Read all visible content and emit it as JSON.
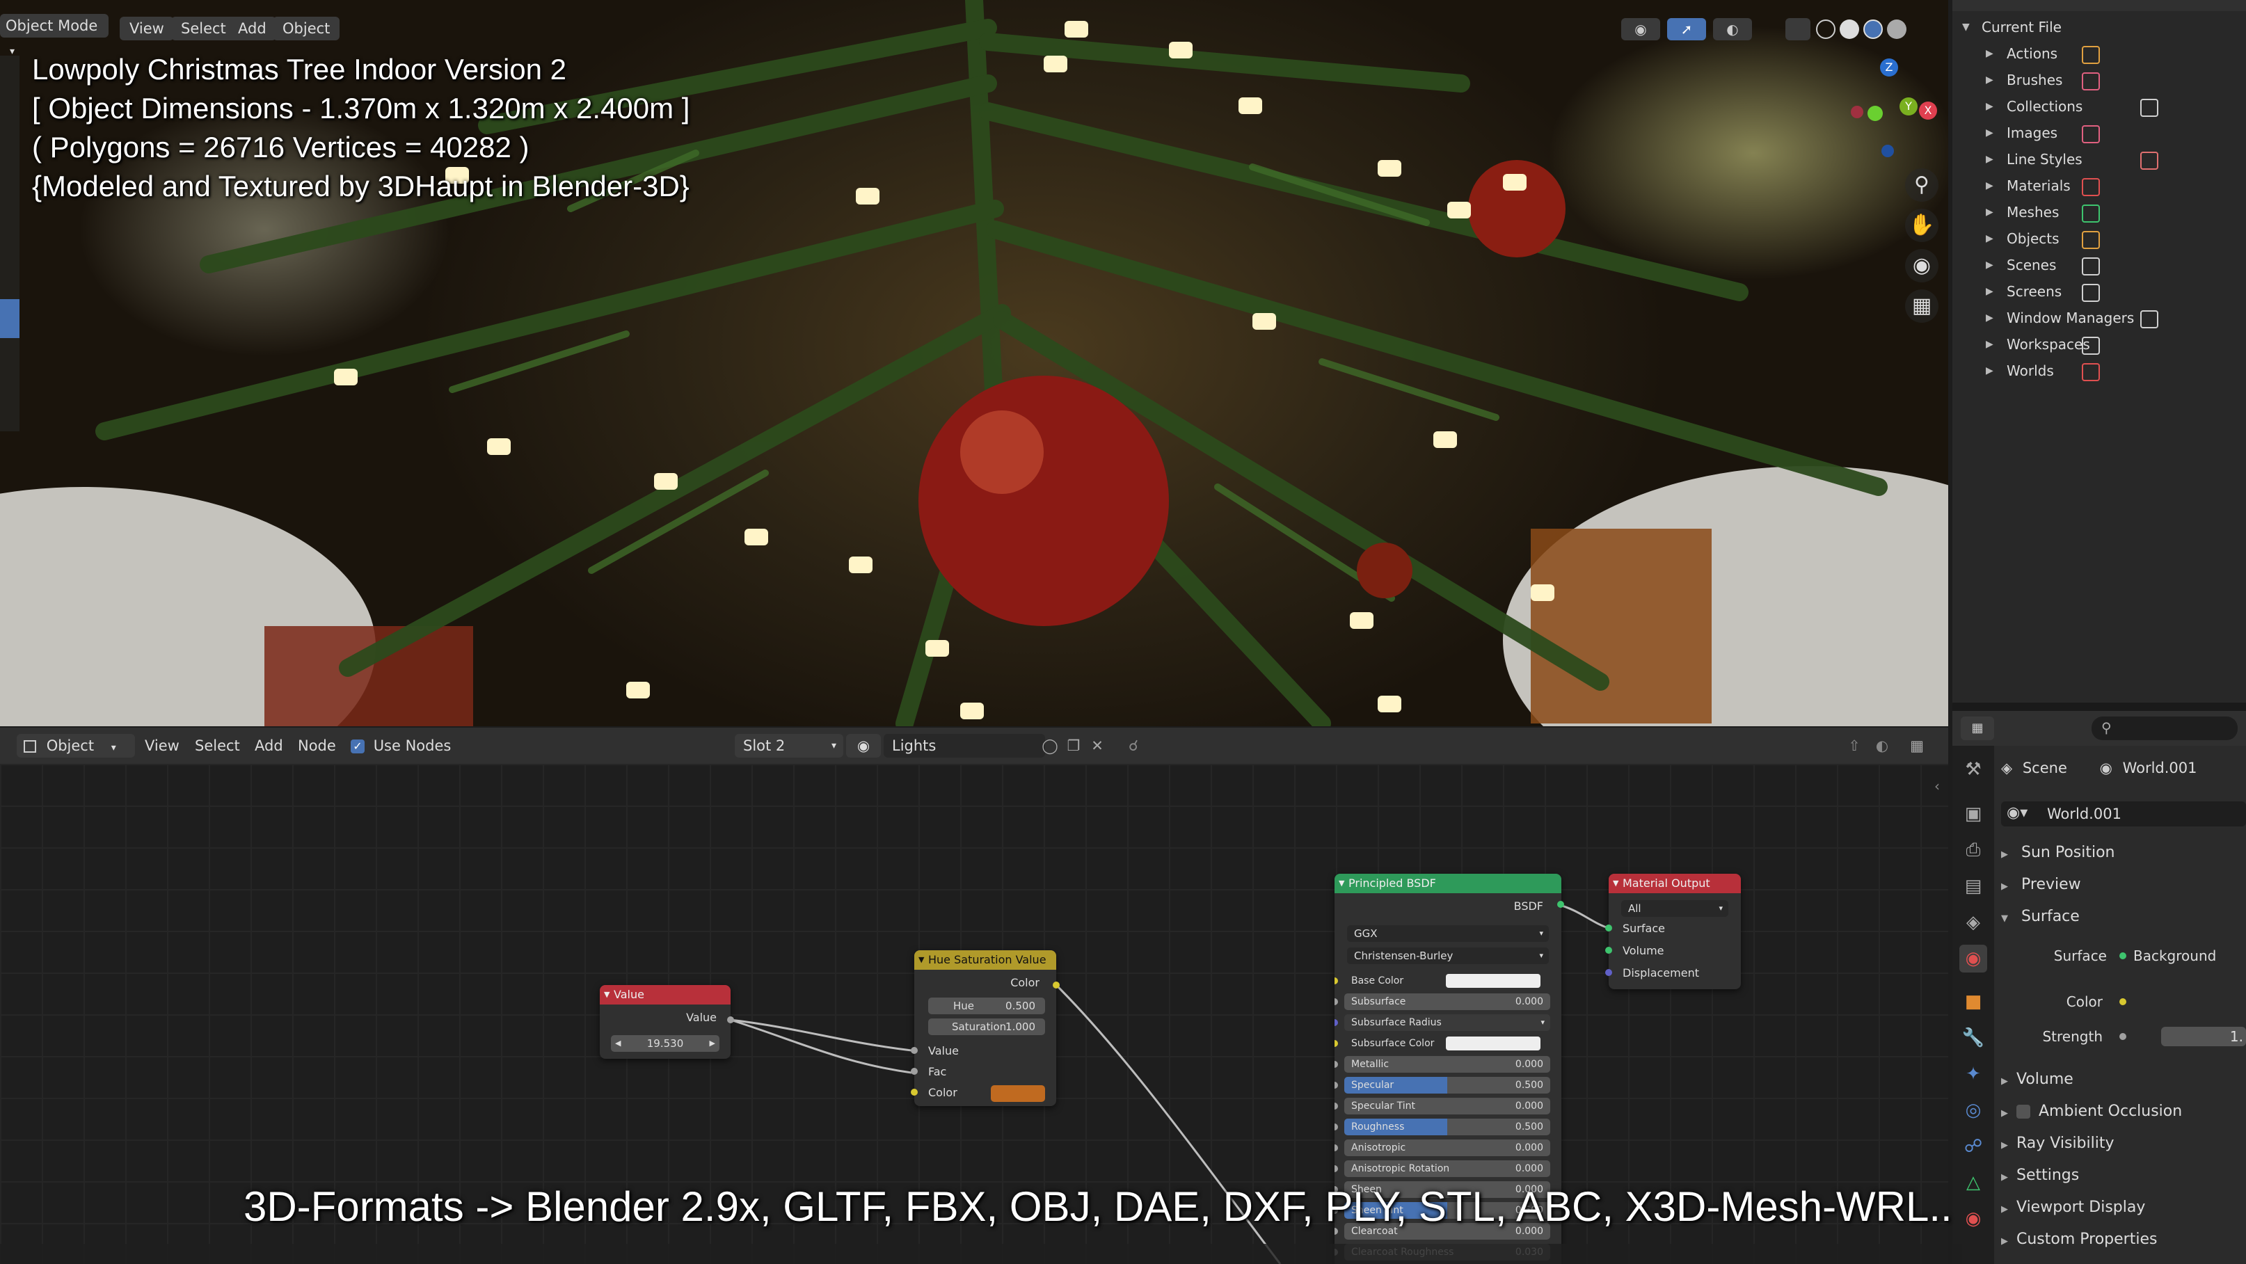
{
  "viewport": {
    "header": {
      "mode_label": "Object Mode",
      "menus": [
        "View",
        "Select",
        "Add",
        "Object"
      ]
    },
    "overlay_text": [
      "Lowpoly Christmas Tree Indoor Version 2",
      "[ Object Dimensions -  1.370m x 1.320m x 2.400m ]",
      "( Polygons = 26716  Vertices = 40282 )",
      "{Modeled and Textured by 3DHaupt in Blender-3D}"
    ]
  },
  "outliner": {
    "root": "Current File",
    "items": [
      {
        "label": "Actions",
        "icon": "action-icon"
      },
      {
        "label": "Brushes",
        "icon": "brush-icon"
      },
      {
        "label": "Collections",
        "icon": "collection-icon"
      },
      {
        "label": "Images",
        "icon": "image-icon"
      },
      {
        "label": "Line Styles",
        "icon": "linestyle-icon"
      },
      {
        "label": "Materials",
        "icon": "material-icon"
      },
      {
        "label": "Meshes",
        "icon": "mesh-icon"
      },
      {
        "label": "Objects",
        "icon": "object-icon"
      },
      {
        "label": "Scenes",
        "icon": "scene-icon"
      },
      {
        "label": "Screens",
        "icon": "screen-icon"
      },
      {
        "label": "Window Managers",
        "icon": "window-icon"
      },
      {
        "label": "Workspaces",
        "icon": "workspace-icon"
      },
      {
        "label": "Worlds",
        "icon": "world-icon"
      }
    ]
  },
  "node_editor": {
    "header": {
      "type_label": "Object",
      "menus": [
        "View",
        "Select",
        "Add",
        "Node"
      ],
      "use_nodes_label": "Use Nodes",
      "slot_label": "Slot 2",
      "material_name": "Lights"
    },
    "nodes": {
      "value": {
        "title": "Value",
        "output": "Value",
        "field_value": "19.530"
      },
      "hsv": {
        "title": "Hue Saturation Value",
        "output": "Color",
        "hue_label": "Hue",
        "hue_value": "0.500",
        "sat_label": "Saturation",
        "sat_value": "1.000",
        "inputs": [
          "Value",
          "Fac",
          "Color"
        ]
      },
      "bsdf": {
        "title": "Principled BSDF",
        "output": "BSDF",
        "distribution": "GGX",
        "subsurface_method": "Christensen-Burley",
        "rows": [
          {
            "label": "Base Color",
            "value": ""
          },
          {
            "label": "Subsurface",
            "value": "0.000"
          },
          {
            "label": "Subsurface Radius",
            "value": ""
          },
          {
            "label": "Subsurface Color",
            "value": ""
          },
          {
            "label": "Metallic",
            "value": "0.000"
          },
          {
            "label": "Specular",
            "value": "0.500"
          },
          {
            "label": "Specular Tint",
            "value": "0.000"
          },
          {
            "label": "Roughness",
            "value": "0.500"
          },
          {
            "label": "Anisotropic",
            "value": "0.000"
          },
          {
            "label": "Anisotropic Rotation",
            "value": "0.000"
          },
          {
            "label": "Sheen",
            "value": "0.000"
          },
          {
            "label": "Sheen Tint",
            "value": "0.500"
          },
          {
            "label": "Clearcoat",
            "value": "0.000"
          },
          {
            "label": "Clearcoat Roughness",
            "value": "0.030"
          }
        ]
      },
      "output": {
        "title": "Material Output",
        "target": "All",
        "inputs": [
          "Surface",
          "Volume",
          "Displacement"
        ]
      }
    }
  },
  "properties": {
    "breadcrumb": {
      "scene": "Scene",
      "world": "World.001"
    },
    "world_name": "World.001",
    "panels_top": [
      "Sun Position",
      "Preview"
    ],
    "surface_panel": "Surface",
    "surface_label": "Surface",
    "surface_value": "Background",
    "color_label": "Color",
    "strength_label": "Strength",
    "strength_value": "1.",
    "panels_bottom": [
      "Volume",
      "Ambient Occlusion",
      "Ray Visibility",
      "Settings",
      "Viewport Display",
      "Custom Properties"
    ]
  },
  "caption": "3D-Formats -> Blender 2.9x, GLTF, FBX, OBJ, DAE, DXF, PLY, STL, ABC, X3D-Mesh-WRL..",
  "colors": {
    "value_header": "#b8303a",
    "hsv_header": "#b09a2a",
    "bsdf_header": "#2e9a5a",
    "output_header": "#b8303a",
    "accent_blue": "#4772b3"
  }
}
